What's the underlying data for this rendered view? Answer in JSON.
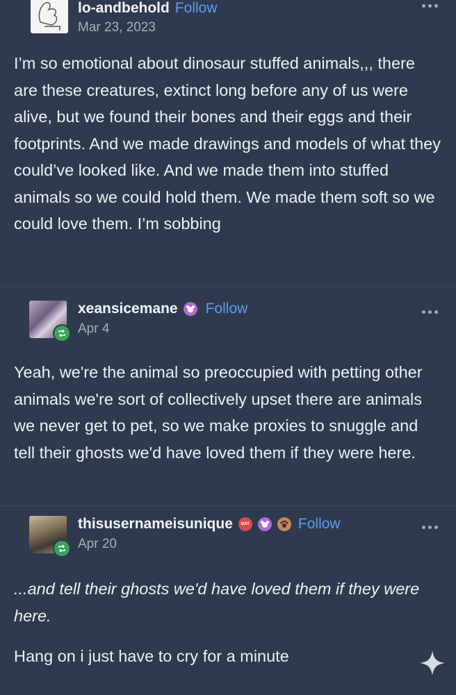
{
  "posts": [
    {
      "username": "lo-andbehold",
      "follow_label": "Follow",
      "date": "Mar 23, 2023",
      "text": "I’m so emotional about dinosaur stuffed animals,,, there are these creatures, extinct long before any of us were alive, but we found their bones and their eggs and their footprints. And we made drawings and models of what they could’ve looked like. And we made them into stuffed animals so we could hold them. We made them soft so we could love them. I’m sobbing"
    },
    {
      "username": "xeansicemane",
      "follow_label": "Follow",
      "date": "Apr 4",
      "text": "Yeah, we're the animal so preoccupied with petting other animals we're sort of collectively upset there are animals we never get to pet, so we make proxies to snuggle and tell their ghosts we'd have loved them if they were here."
    },
    {
      "username": "thisusernameisunique",
      "follow_label": "Follow",
      "date": "Apr 20",
      "quote": "...and tell their ghosts we'd have loved them if they were here.",
      "text": "Hang on i just have to cry for a minute",
      "badge_label": "DAY"
    }
  ],
  "colors": {
    "background": "#2f3a4e",
    "follow": "#5b9cf2",
    "repost_badge": "#3aa35c",
    "text": "#eef0f4",
    "muted": "#a7aebb"
  },
  "icons": [
    "more-options-icon",
    "repost-badge-icon",
    "crab-badge-icon",
    "paw-badge-icon",
    "day-badge-icon",
    "sparkle-icon"
  ]
}
